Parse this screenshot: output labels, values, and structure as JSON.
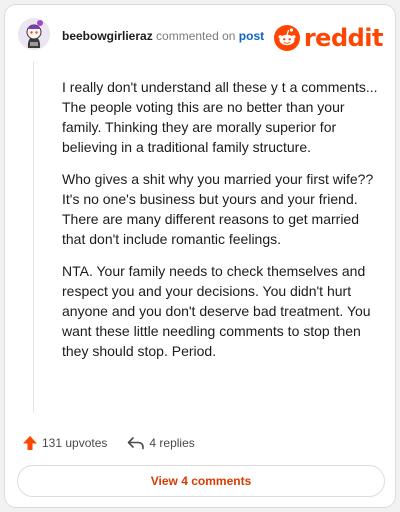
{
  "header": {
    "username": "beebowgirlieraz",
    "commented_text": "commented on",
    "post_link": "post",
    "logo_text": "reddit",
    "brand_color": "#ff4500"
  },
  "comment": {
    "paragraphs": [
      "I really don't understand all these y t a comments... The people voting this are no better than your family. Thinking they are morally superior for believing in a traditional family structure.",
      "Who gives a shit why you married your first wife?? It's no one's business but yours and your friend. There are many different reasons to get married that don't include romantic feelings.",
      "NTA. Your family needs to check themselves and respect you and your decisions. You didn't hurt anyone and you don't deserve bad treatment. You want these little needling comments to stop then they should stop. Period."
    ]
  },
  "actions": {
    "upvotes": "131 upvotes",
    "replies": "4 replies",
    "upvote_icon": "upvote-arrow-icon",
    "reply_icon": "reply-arrow-icon"
  },
  "footer": {
    "view_comments_label": "View 4 comments"
  }
}
